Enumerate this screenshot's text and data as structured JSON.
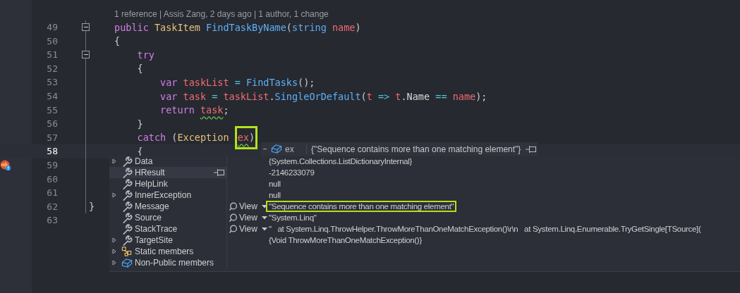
{
  "editor": {
    "codelens": "1 reference | Assis Zang, 2 days ago | 1 author, 1 change",
    "lines": [
      {
        "number": "49",
        "current": false,
        "fold": true,
        "tokens": [
          {
            "text": "public",
            "kind": "keyword"
          },
          {
            "text": " TaskItem",
            "kind": "class"
          },
          {
            "text": " FindTaskByName",
            "kind": "method"
          },
          {
            "text": "(",
            "kind": "punct"
          },
          {
            "text": "string",
            "kind": "builtin"
          },
          {
            "text": " name",
            "kind": "variable"
          },
          {
            "text": ")",
            "kind": "punct"
          }
        ]
      },
      {
        "number": "50",
        "current": false,
        "fold": false,
        "tokens": [
          {
            "text": "{",
            "kind": "punct"
          }
        ]
      },
      {
        "number": "51",
        "current": false,
        "fold": true,
        "tokens": [
          {
            "text": "    try",
            "kind": "keyword"
          }
        ]
      },
      {
        "number": "52",
        "current": false,
        "fold": false,
        "tokens": [
          {
            "text": "    {",
            "kind": "punct"
          }
        ]
      },
      {
        "number": "53",
        "current": false,
        "fold": false,
        "tokens": [
          {
            "text": "        var",
            "kind": "keyword"
          },
          {
            "text": " taskList",
            "kind": "variable"
          },
          {
            "text": " =",
            "kind": "operator"
          },
          {
            "text": " FindTasks",
            "kind": "method"
          },
          {
            "text": "();",
            "kind": "punct"
          }
        ]
      },
      {
        "number": "54",
        "current": false,
        "fold": false,
        "tokens": [
          {
            "text": "        var",
            "kind": "keyword"
          },
          {
            "text": " task",
            "kind": "variable"
          },
          {
            "text": " =",
            "kind": "operator"
          },
          {
            "text": " taskList",
            "kind": "variable"
          },
          {
            "text": ".",
            "kind": "punct"
          },
          {
            "text": "SingleOrDefault",
            "kind": "method"
          },
          {
            "text": "(",
            "kind": "punct"
          },
          {
            "text": "t",
            "kind": "variable"
          },
          {
            "text": " =>",
            "kind": "operator"
          },
          {
            "text": " t",
            "kind": "variable"
          },
          {
            "text": ".",
            "kind": "punct"
          },
          {
            "text": "Name",
            "kind": "member"
          },
          {
            "text": " ==",
            "kind": "operator"
          },
          {
            "text": " name",
            "kind": "variable"
          },
          {
            "text": ");",
            "kind": "punct"
          }
        ]
      },
      {
        "number": "55",
        "current": false,
        "fold": false,
        "tokens": [
          {
            "text": "        return ",
            "kind": "keyword"
          },
          {
            "text": "task",
            "kind": "variable",
            "squiggle": true
          },
          {
            "text": ";",
            "kind": "punct"
          }
        ]
      },
      {
        "number": "56",
        "current": false,
        "fold": false,
        "tokens": [
          {
            "text": "    }",
            "kind": "punct"
          }
        ]
      },
      {
        "number": "57",
        "current": false,
        "fold": false,
        "tokens": [
          {
            "text": "    catch",
            "kind": "keyword"
          },
          {
            "text": " (",
            "kind": "punct"
          },
          {
            "text": "Exception ",
            "kind": "class"
          },
          {
            "text": "ex",
            "kind": "variable",
            "squiggle": true,
            "highlighted": true
          },
          {
            "text": ")",
            "kind": "punct",
            "highlighted": true
          }
        ]
      },
      {
        "number": "58",
        "current": true,
        "fold": false,
        "tokens": [
          {
            "text": "    {",
            "kind": "punct"
          }
        ]
      },
      {
        "number": "59",
        "current": false,
        "fold": false,
        "exception_marker": true
      },
      {
        "number": "60",
        "current": false,
        "fold": false
      },
      {
        "number": "61",
        "current": false,
        "fold": false
      },
      {
        "number": "62",
        "current": false,
        "fold": false,
        "gutter_text": "}"
      },
      {
        "number": "63",
        "current": false,
        "fold": false
      }
    ]
  },
  "datatip": {
    "name": "ex",
    "value": "{\"Sequence contains more than one matching element\"}",
    "rows": [
      {
        "name": "Data",
        "kind": "property",
        "expandable": true,
        "hovered": false,
        "value": "{System.Collections.ListDictionaryInternal}",
        "highlighted": false
      },
      {
        "name": "HResult",
        "kind": "property",
        "expandable": false,
        "hovered": true,
        "value": "-2146233079",
        "highlighted": false
      },
      {
        "name": "HelpLink",
        "kind": "property",
        "expandable": false,
        "hovered": false,
        "value": "null",
        "highlighted": false
      },
      {
        "name": "InnerException",
        "kind": "property",
        "expandable": true,
        "hovered": false,
        "value": "null",
        "highlighted": false
      },
      {
        "name": "Message",
        "kind": "property",
        "expandable": false,
        "hovered": false,
        "view": "View",
        "value": "\"Sequence contains more than one matching element\"",
        "highlighted": true
      },
      {
        "name": "Source",
        "kind": "property",
        "expandable": false,
        "hovered": false,
        "view": "View",
        "value": "\"System.Linq\"",
        "highlighted": false
      },
      {
        "name": "StackTrace",
        "kind": "property",
        "expandable": false,
        "hovered": false,
        "view": "View",
        "value": "\"   at System.Linq.ThrowHelper.ThrowMoreThanOneMatchException()\\r\\n   at System.Linq.Enumerable.TryGetSingle[TSource](",
        "highlighted": false
      },
      {
        "name": "TargetSite",
        "kind": "property",
        "expandable": true,
        "hovered": false,
        "value": "{Void ThrowMoreThanOneMatchException()}",
        "highlighted": false
      },
      {
        "name": "Static members",
        "kind": "static",
        "expandable": true,
        "hovered": false,
        "highlighted": false
      },
      {
        "name": "Non-Public members",
        "kind": "nonpublic",
        "expandable": true,
        "hovered": false,
        "highlighted": false
      }
    ]
  }
}
